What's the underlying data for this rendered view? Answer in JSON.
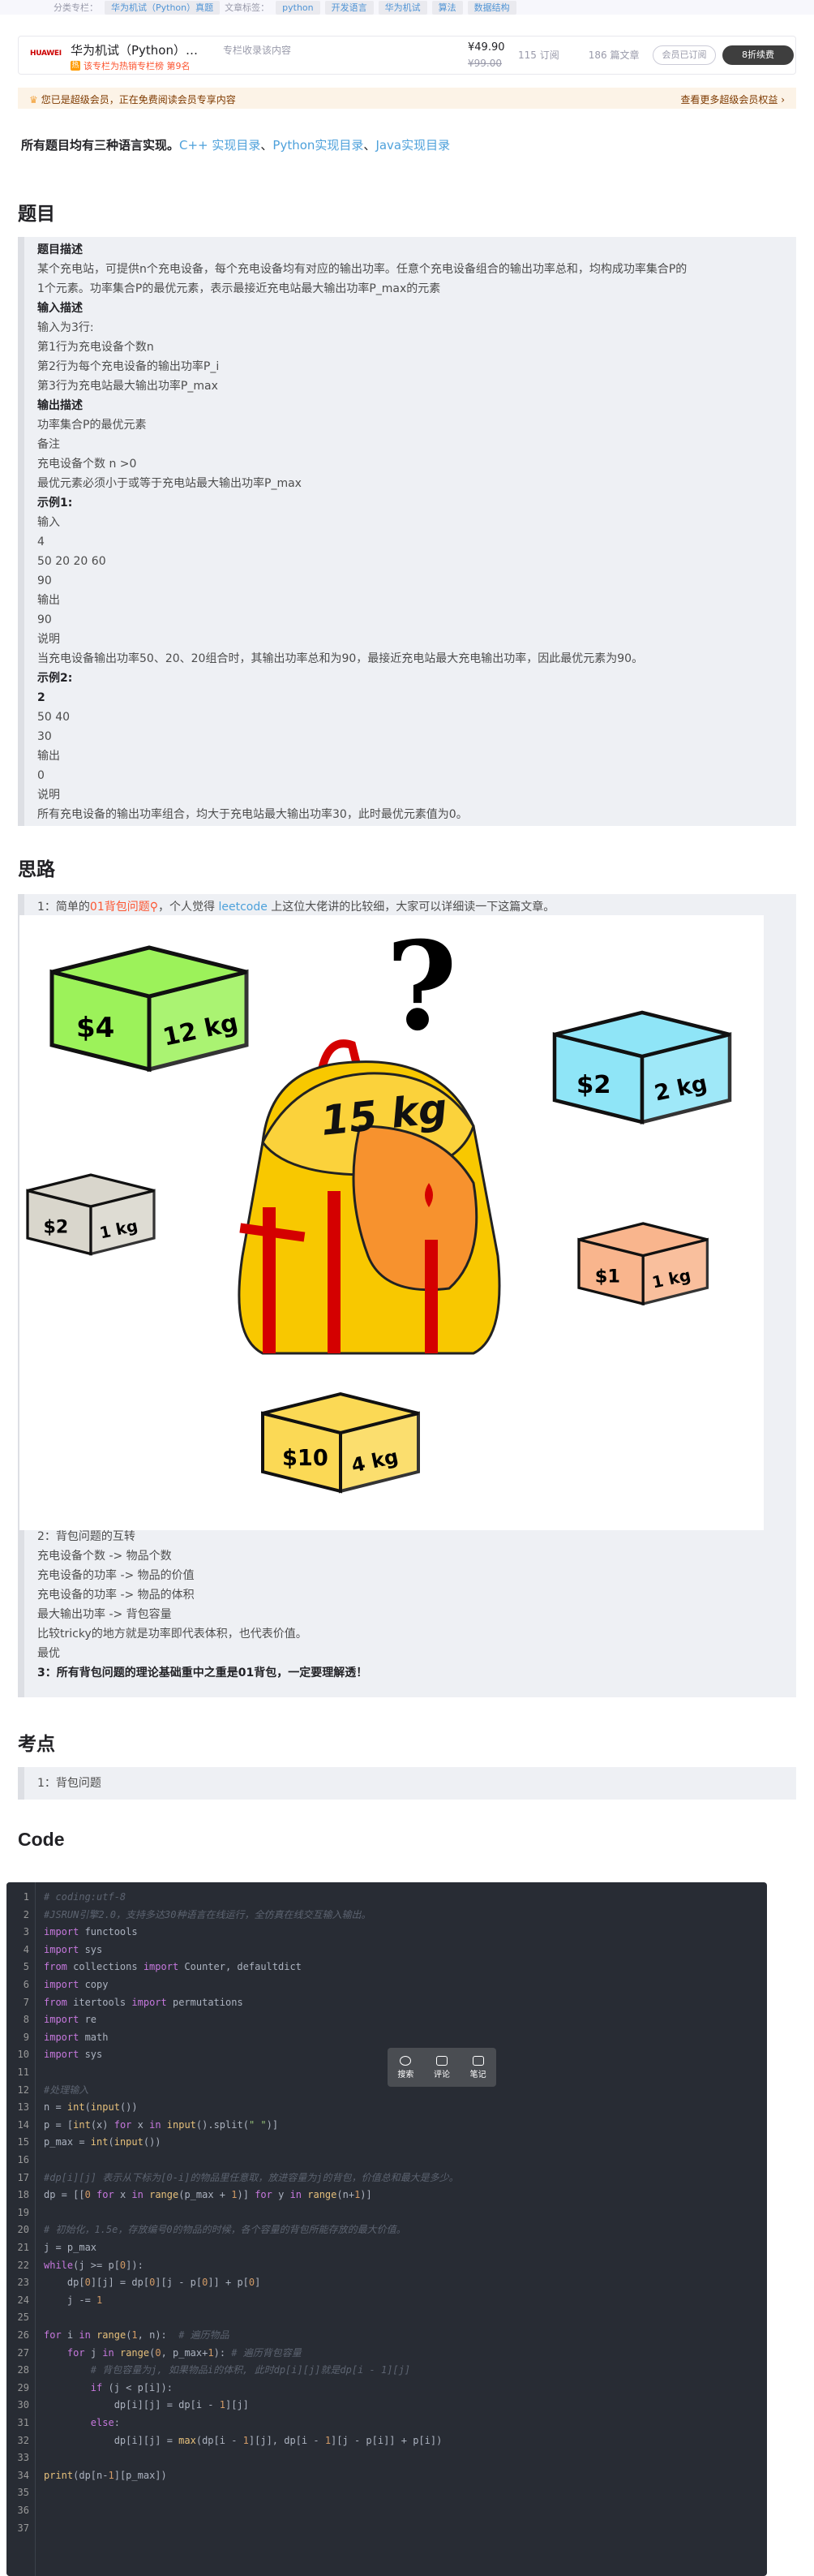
{
  "tags_bar": {
    "column_label": "分类专栏：",
    "column_tag": "华为机试（Python）真题",
    "tag_label": "文章标签：",
    "tags": [
      "python",
      "开发语言",
      "华为机试",
      "算法",
      "数据结构"
    ]
  },
  "column_card": {
    "logo": "HUAWEI",
    "title": "华为机试（Python）…",
    "desc": "专栏收录该内容",
    "badge": "该专栏为热销专栏榜 第9名",
    "price": "¥49.90",
    "old_price": "¥99.00",
    "subs": "115 订阅",
    "articles": "186 篇文章",
    "btn_subscribed": "会员已订阅",
    "btn_sub": "8折续费"
  },
  "vip": {
    "left": "您已是超级会员，正在免费阅读会员专享内容",
    "right": "查看更多超级会员权益 ›"
  },
  "intro": {
    "text": "所有题目均有三种语言实现。",
    "link1": "C++ 实现目录",
    "link2": "Python实现目录",
    "link3": "Java实现目录",
    "sep": "、"
  },
  "headings": {
    "problem": "题目",
    "idea": "思路",
    "points": "考点",
    "code": "Code"
  },
  "problem_lines": [
    {
      "t": "题目描述",
      "b": true
    },
    {
      "t": "某个充电站，可提供n个充电设备，每个充电设备均有对应的输出功率。任意个充电设备组合的输出功率总和，均构成功率集合P的",
      "b": false
    },
    {
      "t": "1个元素。功率集合P的最优元素，表示最接近充电站最大输出功率P_max的元素",
      "b": false
    },
    {
      "t": "输入描述",
      "b": true
    },
    {
      "t": "输入为3行:",
      "b": false
    },
    {
      "t": "第1行为充电设备个数n",
      "b": false
    },
    {
      "t": "第2行为每个充电设备的输出功率P_i",
      "b": false
    },
    {
      "t": "第3行为充电站最大输出功率P_max",
      "b": false
    },
    {
      "t": "输出描述",
      "b": true
    },
    {
      "t": "功率集合P的最优元素",
      "b": false
    },
    {
      "t": "备注",
      "b": false
    },
    {
      "t": "充电设备个数 n >0",
      "b": false
    },
    {
      "t": "最优元素必须小于或等于充电站最大输出功率P_max",
      "b": false
    },
    {
      "t": "示例1:",
      "b": true
    },
    {
      "t": "输入",
      "b": false
    },
    {
      "t": "4",
      "b": false
    },
    {
      "t": "50 20 20 60",
      "b": false
    },
    {
      "t": "90",
      "b": false
    },
    {
      "t": "输出",
      "b": false
    },
    {
      "t": "90",
      "b": false
    },
    {
      "t": "说明",
      "b": false
    },
    {
      "t": "当充电设备输出功率50、20、20组合时，其输出功率总和为90，最接近充电站最大充电输出功率，因此最优元素为90。",
      "b": false
    },
    {
      "t": "示例2:",
      "b": true
    },
    {
      "t": "2",
      "b": true
    },
    {
      "t": "50 40",
      "b": false
    },
    {
      "t": "30",
      "b": false
    },
    {
      "t": "输出",
      "b": false
    },
    {
      "t": "0",
      "b": false
    },
    {
      "t": "说明",
      "b": false
    },
    {
      "t": "所有充电设备的输出功率组合，均大于充电站最大输出功率30，此时最优元素值为0。",
      "b": false
    }
  ],
  "idea": {
    "l1_pre": "1：简单的",
    "l1_red": "01背包问题",
    "l1_mid": "，个人觉得 ",
    "l1_link": "leetcode",
    "l1_post": " 上这位大佬讲的比较细，大家可以详细读一下这篇文章。",
    "image": {
      "question": "?",
      "bag": "15 kg",
      "boxes": [
        {
          "price": "$4",
          "weight": "12 kg",
          "color": "#9cf25a"
        },
        {
          "price": "$2",
          "weight": "2 kg",
          "color": "#8fe5f7"
        },
        {
          "price": "$2",
          "weight": "1 kg",
          "color": "#d9d6cc"
        },
        {
          "price": "$1",
          "weight": "1 kg",
          "color": "#f9b58d"
        },
        {
          "price": "$10",
          "weight": "4 kg",
          "color": "#fbd955"
        }
      ]
    },
    "lines": [
      {
        "t": "2：背包问题的互转",
        "b": false
      },
      {
        "t": "充电设备个数 -> 物品个数",
        "b": false
      },
      {
        "t": "充电设备的功率 -> 物品的价值",
        "b": false
      },
      {
        "t": "充电设备的功率 -> 物品的体积",
        "b": false
      },
      {
        "t": "最大输出功率 -> 背包容量",
        "b": false
      },
      {
        "t": "比较tricky的地方就是功率即代表体积，也代表价值。",
        "b": false
      },
      {
        "t": "最优",
        "b": false
      },
      {
        "t": "3：所有背包问题的理论基础重中之重是01背包，一定要理解透！",
        "b": true
      }
    ]
  },
  "points": [
    "1：背包问题"
  ],
  "toolbar": {
    "search": "搜索",
    "comment": "评论",
    "note": "笔记"
  },
  "code_lines": [
    "<span class=\"cm\"># coding:utf-8</span>",
    "<span class=\"cm\">#JSRUN引擎2.0，支持多达30种语言在线运行，全仿真在线交互输入输出。</span>",
    "<span class=\"kw\">import</span> functools",
    "<span class=\"kw\">import</span> sys",
    "<span class=\"kw\">from</span> collections <span class=\"kw\">import</span> Counter, defaultdict",
    "<span class=\"kw\">import</span> copy",
    "<span class=\"kw\">from</span> itertools <span class=\"kw\">import</span> permutations",
    "<span class=\"kw\">import</span> re",
    "<span class=\"kw\">import</span> math",
    "<span class=\"kw\">import</span> sys",
    "",
    "<span class=\"cm\">#处理输入</span>",
    "n = <span class=\"bi\">int</span>(<span class=\"bi\">input</span>())",
    "p = [<span class=\"bi\">int</span>(x) <span class=\"kw\">for</span> x <span class=\"kw\">in</span> <span class=\"bi\">input</span>().split(<span class=\"st\">\" \"</span>)]",
    "p_max = <span class=\"bi\">int</span>(<span class=\"bi\">input</span>())",
    "",
    "<span class=\"cm\">#dp[i][j] 表示从下标为[0-i]的物品里任意取，放进容量为j的背包，价值总和最大是多少。</span>",
    "dp = [[<span class=\"nm\">0</span> <span class=\"kw\">for</span> x <span class=\"kw\">in</span> <span class=\"bi\">range</span>(p_max + <span class=\"nm\">1</span>)] <span class=\"kw\">for</span> y <span class=\"kw\">in</span> <span class=\"bi\">range</span>(n+<span class=\"nm\">1</span>)]",
    "",
    "<span class=\"cm\"># 初始化，1.5e，存放编号0的物品的时候，各个容量的背包所能存放的最大价值。</span>",
    "j = p_max",
    "<span class=\"kw\">while</span>(j &gt;= p[<span class=\"nm\">0</span>]):",
    "    dp[<span class=\"nm\">0</span>][j] = dp[<span class=\"nm\">0</span>][j - p[<span class=\"nm\">0</span>]] + p[<span class=\"nm\">0</span>]",
    "    j -= <span class=\"nm\">1</span>",
    "",
    "<span class=\"kw\">for</span> i <span class=\"kw\">in</span> <span class=\"bi\">range</span>(<span class=\"nm\">1</span>, n):  <span class=\"cm\"># 遍历物品</span>",
    "    <span class=\"kw\">for</span> j <span class=\"kw\">in</span> <span class=\"bi\">range</span>(<span class=\"nm\">0</span>, p_max+<span class=\"nm\">1</span>): <span class=\"cm\"># 遍历背包容量</span>",
    "        <span class=\"cm\"># 背包容量为j, 如果物品i的体积, 此时dp[i][j]就是dp[i - 1][j]</span>",
    "        <span class=\"kw\">if</span> (j &lt; p[i]):",
    "            dp[i][j] = dp[i - <span class=\"nm\">1</span>][j]",
    "        <span class=\"kw\">else</span>:",
    "            dp[i][j] = <span class=\"bi\">max</span>(dp[i - <span class=\"nm\">1</span>][j], dp[i - <span class=\"nm\">1</span>][j - p[i]] + p[i])",
    "",
    "<span class=\"bi\">print</span>(dp[n-<span class=\"nm\">1</span>][p_max])",
    "",
    "",
    ""
  ],
  "colors": {
    "accent": "#4ea1db",
    "red": "#fc5531",
    "code_bg": "#282c34",
    "quote_bg": "#eef0f4"
  }
}
